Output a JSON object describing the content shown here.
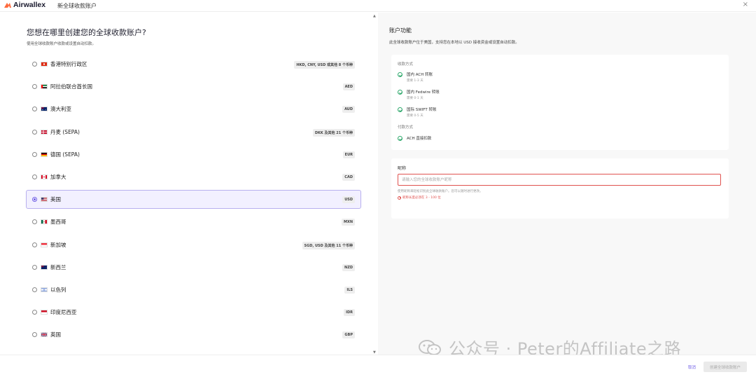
{
  "header": {
    "brand": "Airwallex",
    "page_title": "新全球收款账户",
    "close_icon": "close-icon"
  },
  "left": {
    "title": "您想在哪里创建您的全球收款账户?",
    "subtitle": "使用全球收款账户收款或设置自动扣款。",
    "countries": [
      {
        "name": "香港特别行政区",
        "badge": "HKD, CNY, USD 或其他 8 个币种",
        "flag": "hk",
        "selected": false
      },
      {
        "name": "阿拉伯联合酋长国",
        "badge": "AED",
        "flag": "ae",
        "selected": false
      },
      {
        "name": "澳大利亚",
        "badge": "AUD",
        "flag": "au",
        "selected": false
      },
      {
        "name": "丹麦 (SEPA)",
        "badge": "DKK 及其他 21 个币种",
        "flag": "dk",
        "selected": false
      },
      {
        "name": "德国 (SEPA)",
        "badge": "EUR",
        "flag": "de",
        "selected": false
      },
      {
        "name": "加拿大",
        "badge": "CAD",
        "flag": "ca",
        "selected": false
      },
      {
        "name": "美国",
        "badge": "USD",
        "flag": "us",
        "selected": true
      },
      {
        "name": "墨西哥",
        "badge": "MXN",
        "flag": "mx",
        "selected": false
      },
      {
        "name": "新加坡",
        "badge": "SGD, USD 及其他 11 个币种",
        "flag": "sg",
        "selected": false
      },
      {
        "name": "新西兰",
        "badge": "NZD",
        "flag": "nz",
        "selected": false
      },
      {
        "name": "以色列",
        "badge": "ILS",
        "flag": "il",
        "selected": false
      },
      {
        "name": "印度尼西亚",
        "badge": "IDR",
        "flag": "id",
        "selected": false
      },
      {
        "name": "英国",
        "badge": "GBP",
        "flag": "gb",
        "selected": false
      }
    ]
  },
  "right": {
    "title": "账户功能",
    "desc": "此全球收款账户位于美国，支持您在本地以 USD 接收资金或设置自动扣款。",
    "receive_label": "收款方式",
    "receive_methods": [
      {
        "name": "国内 ACH 转账",
        "time": "需要 1-3 天"
      },
      {
        "name": "国内 Fedwire 转账",
        "time": "需要 0-1 天"
      },
      {
        "name": "国际 SWIFT 转账",
        "time": "需要 0-5 天"
      }
    ],
    "pay_label": "付款方式",
    "pay_methods": [
      {
        "name": "ACH 直接扣款"
      }
    ],
    "nickname_label": "昵称",
    "nickname_placeholder": "请输入您的全球收款账户昵称",
    "nickname_help": "使用昵称来轻松识别此全球收款账户。您可以随时进行更改。",
    "nickname_error": "昵称长度必须在 3 - 100 位"
  },
  "footer": {
    "cancel": "取消",
    "create": "创建全球收款账户"
  },
  "watermark": "公众号 · Peter的Affiliate之路",
  "colors": {
    "accent": "#6e5ce6",
    "error": "#e0524f",
    "success": "#2ea86b",
    "brand_orange": "#ff6a3d"
  }
}
